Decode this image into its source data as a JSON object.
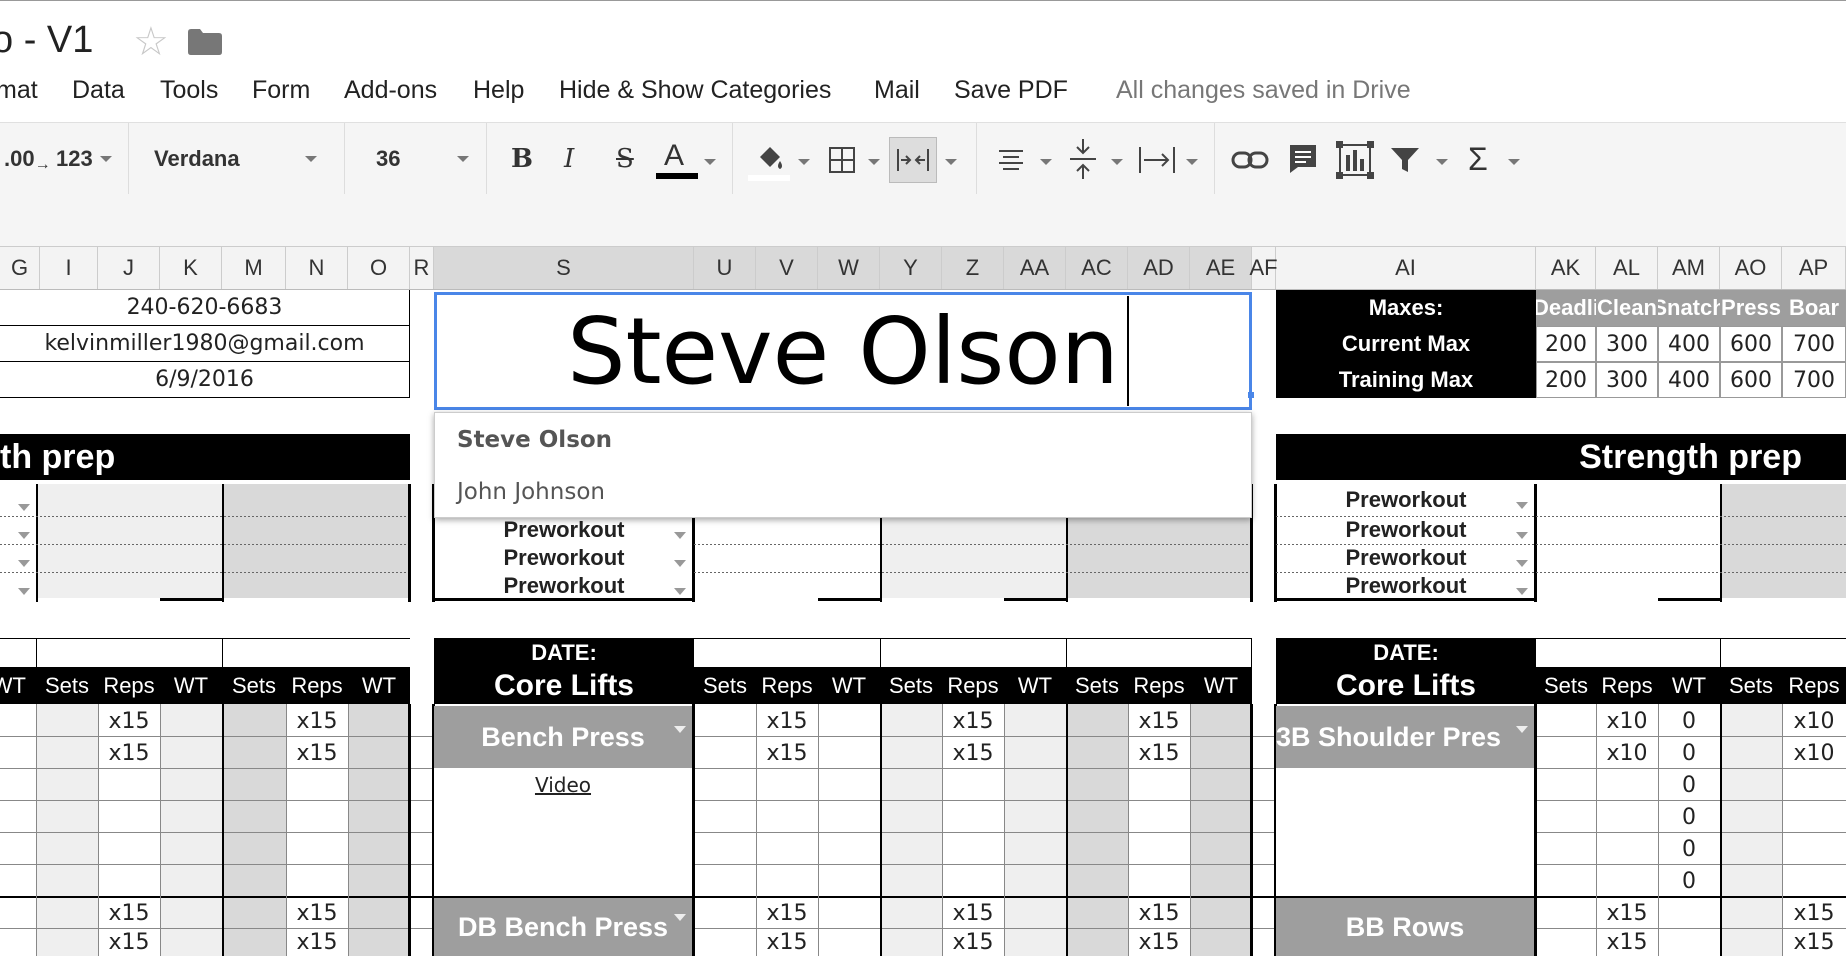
{
  "window": {
    "title": "o - V1",
    "saved_status": "All changes saved in Drive"
  },
  "menu": [
    "mat",
    "Data",
    "Tools",
    "Form",
    "Add-ons",
    "Help",
    "Hide & Show Categories",
    "Mail",
    "Save PDF"
  ],
  "toolbar": {
    "decimal_label": ".00",
    "number_format": "123",
    "font": "Verdana",
    "font_size": "36"
  },
  "columns": [
    "G",
    "I",
    "J",
    "K",
    "M",
    "N",
    "O",
    "R",
    "S",
    "U",
    "V",
    "W",
    "Y",
    "Z",
    "AA",
    "AC",
    "AD",
    "AE",
    "AF",
    "AI",
    "AK",
    "AL",
    "AM",
    "AO",
    "AP"
  ],
  "info": {
    "phone": "240-620-6683",
    "email": "kelvinmiller1980@gmail.com",
    "date": "6/9/2016"
  },
  "editor": {
    "value": "Steve Olson"
  },
  "autocomplete": [
    "Steve Olson",
    "John Johnson"
  ],
  "maxes": {
    "header": "Maxes:",
    "current_label": "Current Max",
    "training_label": "Training Max",
    "lifts": [
      "Deadli",
      "Clean",
      "Snatch",
      "Press",
      "Boar"
    ],
    "current": [
      "200",
      "300",
      "400",
      "600",
      "700"
    ],
    "training": [
      "200",
      "300",
      "400",
      "600",
      "700"
    ]
  },
  "sections": {
    "strength_prep_left": "th prep",
    "strength_prep_right": "Strength prep",
    "preworkout": "Preworkout",
    "date_label": "DATE:",
    "core_lifts": "Core Lifts",
    "video": "Video"
  },
  "table_headers": {
    "sets": "Sets",
    "reps": "Reps",
    "wt": "WT",
    "wt_partial": "WT"
  },
  "lifts": {
    "bench_press": "Bench Press",
    "db_bench_press": "DB Bench Press",
    "bb_shoulder_press": "3B Shoulder Pres",
    "bb_rows": "BB Rows"
  },
  "values": {
    "x15": "x15",
    "x10": "x10",
    "zero": "0"
  }
}
